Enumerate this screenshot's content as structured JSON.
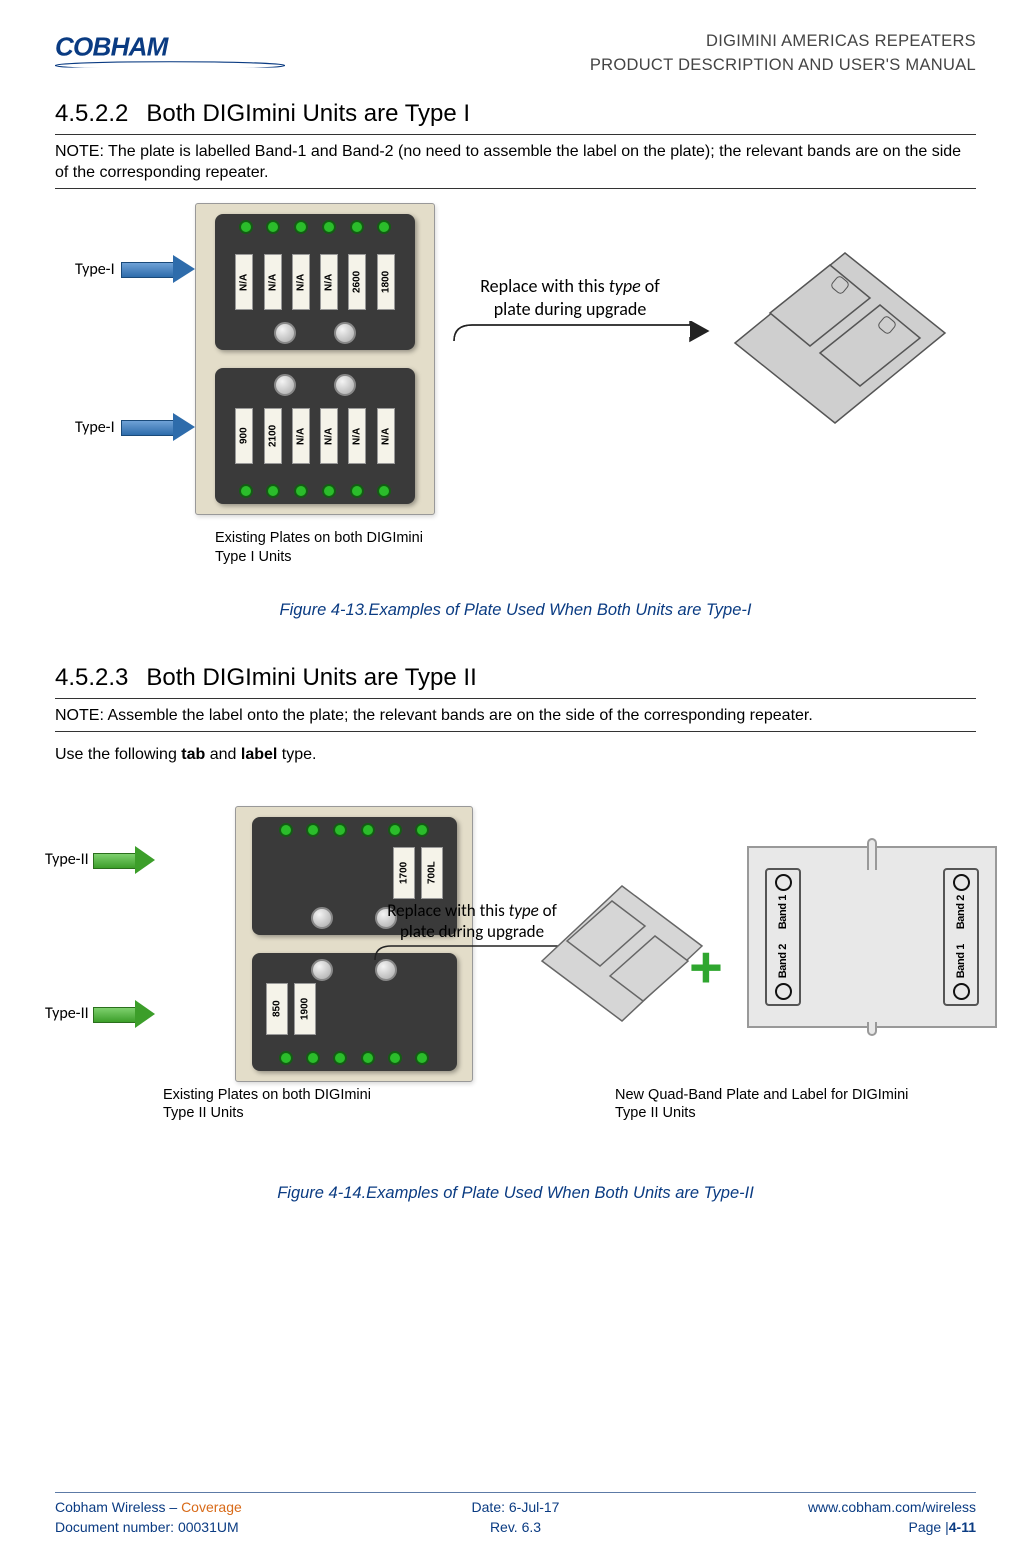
{
  "header": {
    "logo_text": "COBHAM",
    "line1": "DIGIMINI AMERICAS REPEATERS",
    "line2": "PRODUCT DESCRIPTION AND USER'S MANUAL"
  },
  "s1": {
    "num": "4.5.2.2",
    "title": "Both DIGImini Units are Type I",
    "note": "NOTE: The plate is labelled Band-1 and Band-2 (no need to assemble the label on the plate);  the relevant bands are on the side of the corresponding repeater.",
    "type_label": "Type-I",
    "chip1_labels": [
      "N/A",
      "N/A",
      "N/A",
      "N/A",
      "2600",
      "1800"
    ],
    "chip2_labels": [
      "900",
      "2100",
      "N/A",
      "N/A",
      "N/A",
      "N/A"
    ],
    "replace": "Replace with this type of plate during upgrade",
    "under": "Existing Plates on both DIGImini Type I Units"
  },
  "fig1": "Figure 4-13.Examples of Plate Used When Both Units are Type-I",
  "s2": {
    "num": "4.5.2.3",
    "title": "Both DIGImini Units are Type II",
    "note": "NOTE: Assemble the label onto the plate; the relevant bands are on the side of the corresponding repeater.",
    "body": "Use the following tab and label type.",
    "type_label": "Type-II",
    "chip1_labels": [
      "1700",
      "700L"
    ],
    "chip2_labels": [
      "850",
      "1900"
    ],
    "replace": "Replace with this type of plate during upgrade",
    "under_left": "Existing Plates on both DIGImini Type II Units",
    "under_right": "New Quad-Band Plate and Label for DIGImini Type II Units",
    "slot_labels": [
      "Band 2",
      "Band 1",
      "Band 1",
      "Band 2"
    ]
  },
  "fig2": "Figure 4-14.Examples of Plate Used When Both Units are Type-II",
  "footer": {
    "l1a": "Cobham Wireless",
    "l1b": " – ",
    "l1c": "Coverage",
    "c1": "Date: 6-Jul-17",
    "r1": "www.cobham.com/wireless",
    "l2": "Document number: 00031UM",
    "c2": "Rev. 6.3",
    "r2a": "Page |",
    "r2b": "4-11"
  }
}
